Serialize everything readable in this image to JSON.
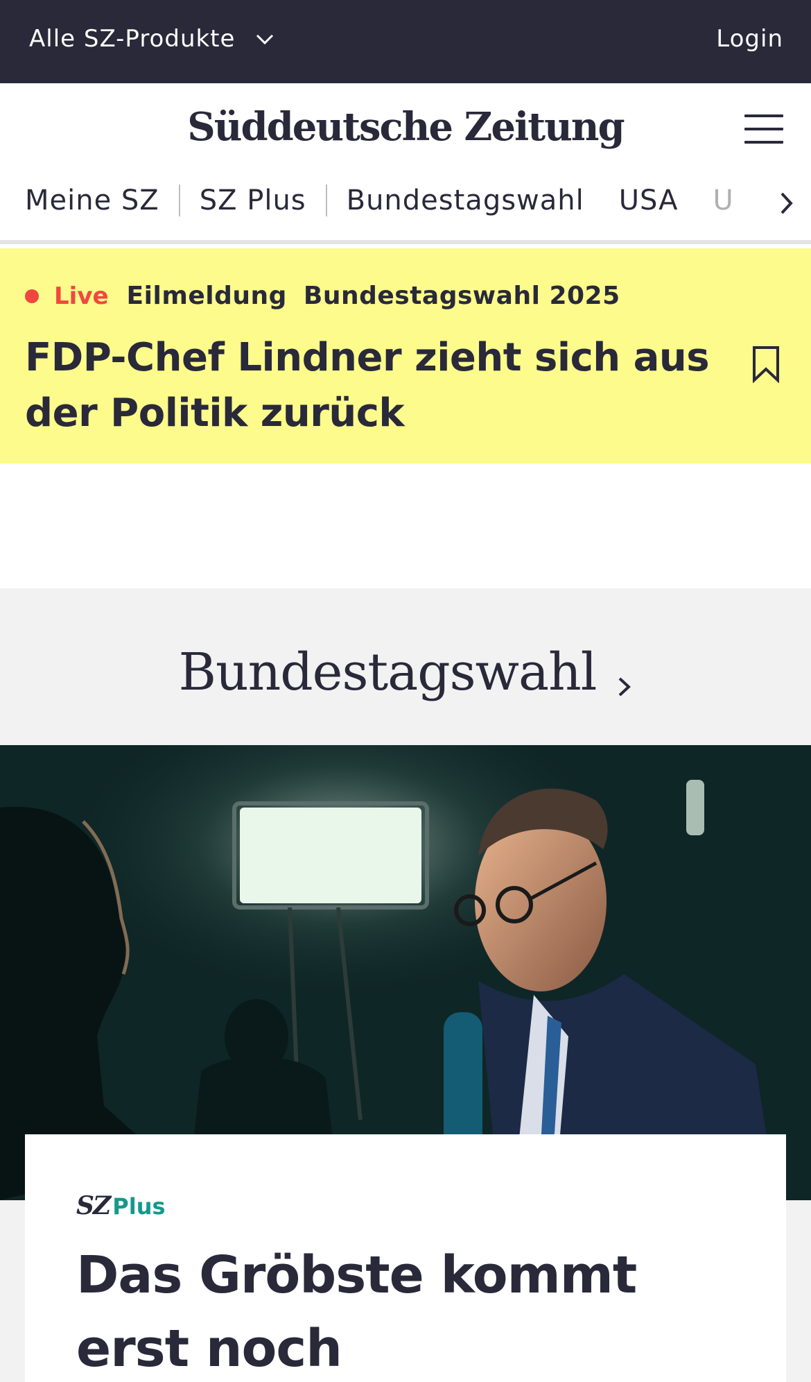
{
  "topbar": {
    "products_label": "Alle SZ-Produkte",
    "login_label": "Login"
  },
  "header": {
    "logo_text": "Süddeutsche Zeitung"
  },
  "nav": {
    "items": [
      "Meine SZ",
      "SZ Plus",
      "Bundestagswahl",
      "USA",
      "U"
    ]
  },
  "breaking": {
    "live_label": "Live",
    "tag1": "Eilmeldung",
    "tag2": "Bundestagswahl 2025",
    "headline": "FDP-Chef Lindner zieht sich aus der Politik zurück"
  },
  "section": {
    "title": "Bundestagswahl"
  },
  "teaser": {
    "brand_sz": "SZ",
    "brand_plus": "Plus",
    "headline": "Das Gröbste kommt erst noch"
  },
  "colors": {
    "dark": "#29293a",
    "breaking_bg": "#fcfb8c",
    "live_red": "#f0483e",
    "plus_teal": "#14998c",
    "section_bg": "#f2f2f2"
  },
  "icons": [
    "chevron-down-icon",
    "hamburger-menu-icon",
    "chevron-right-icon",
    "bookmark-icon",
    "live-dot-icon"
  ]
}
